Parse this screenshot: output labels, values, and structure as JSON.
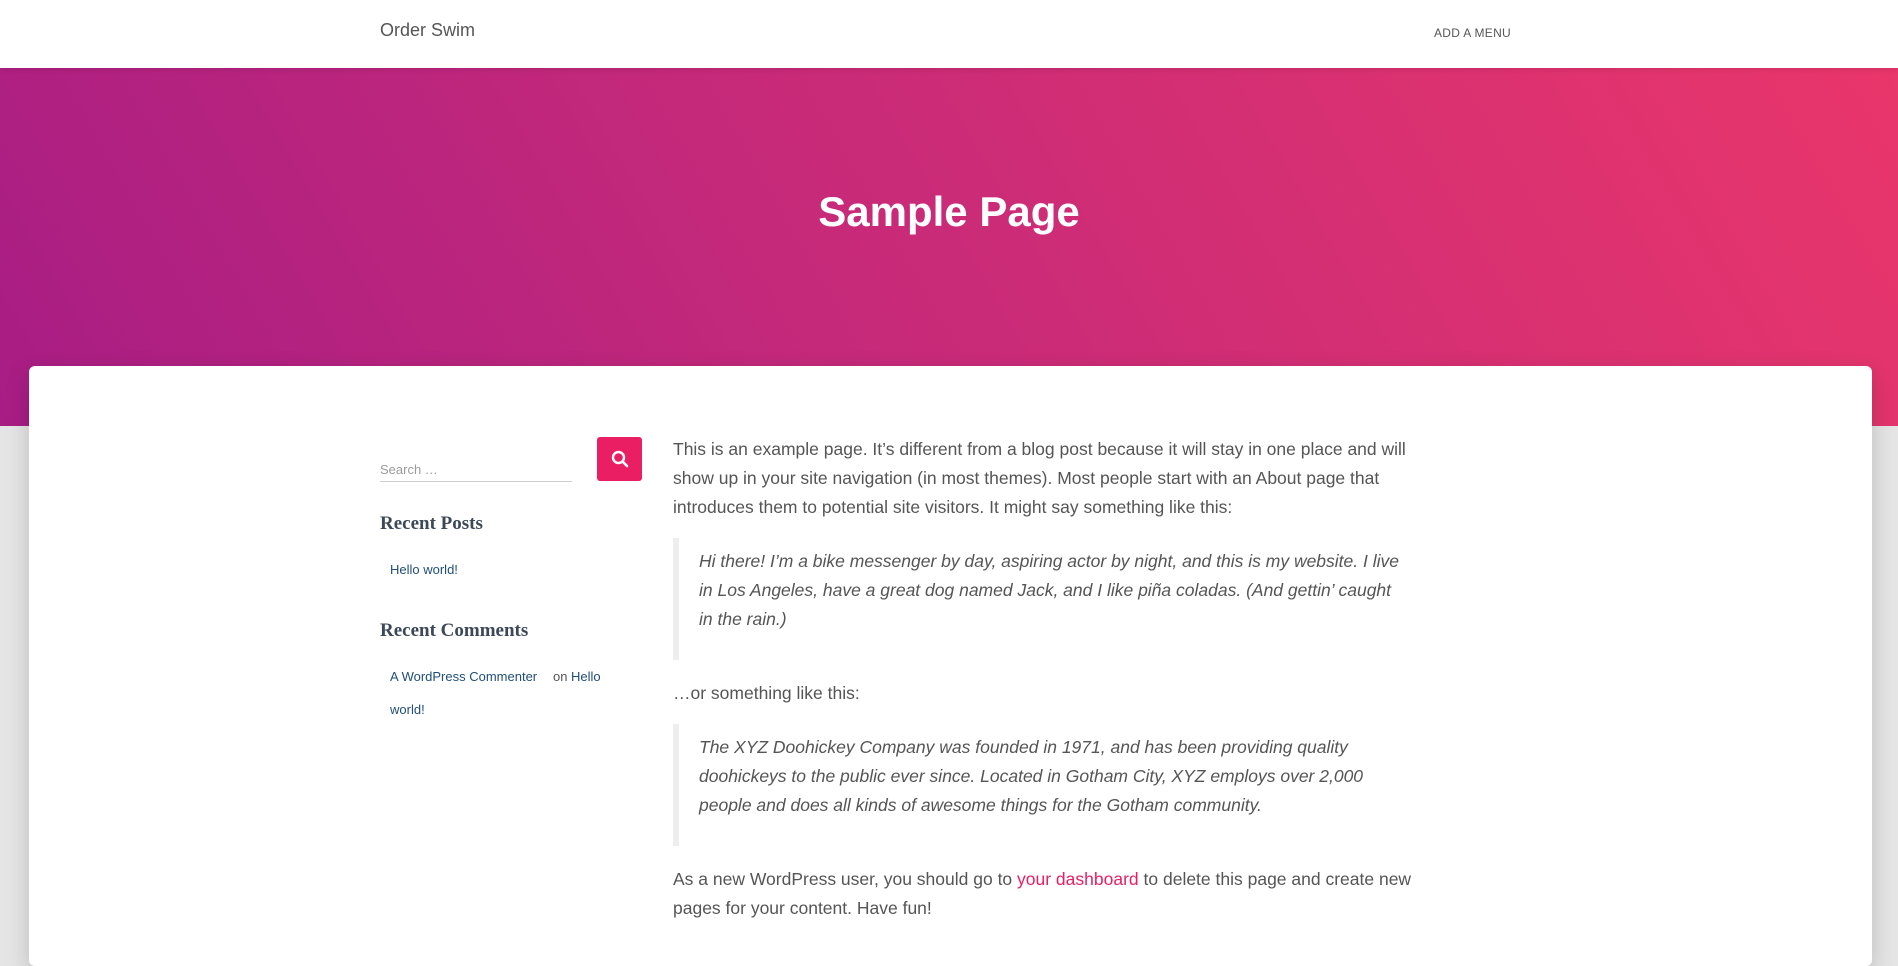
{
  "header": {
    "site_title": "Order Swim",
    "menu_label": "ADD A MENU"
  },
  "hero": {
    "title": "Sample Page"
  },
  "sidebar": {
    "search_placeholder": "Search …",
    "search_button_icon": "search-icon",
    "recent_posts_title": "Recent Posts",
    "recent_posts": [
      "Hello world!"
    ],
    "recent_comments_title": "Recent Comments",
    "comment_author": "A WordPress Commenter",
    "comment_on": "on",
    "comment_post_line1": "Hello",
    "comment_post_line2": "world!"
  },
  "content": {
    "para1_line1": "This is an example page. It’s different from a blog post because it will stay in one place and will",
    "para1_line2": "show up in your site navigation (in most themes). Most people start with an About page that",
    "para1_line3": "introduces them to potential site visitors. It might say something like this:",
    "quote1_line1": "Hi there! I’m a bike messenger by day, aspiring actor by night, and this is my website. I live",
    "quote1_line2": "in Los Angeles, have a great dog named Jack, and I like piña coladas. (And gettin’ caught",
    "quote1_line3": "in the rain.)",
    "para2": "…or something like this:",
    "quote2_line1": "The XYZ Doohickey Company was founded in 1971, and has been providing quality",
    "quote2_line2": "doohickeys to the public ever since. Located in Gotham City, XYZ employs over 2,000",
    "quote2_line3": "people and does all kinds of awesome things for the Gotham community.",
    "para3_before": "As a new WordPress user, you should go to ",
    "para3_link": "your dashboard",
    "para3_after": " to delete this page and create new",
    "para3_line2": "pages for your content. Have fun!"
  },
  "colors": {
    "accent": "#e91e63",
    "hero_gradient_start": "#a81d84",
    "hero_gradient_end": "#e9366b",
    "sidebar_link": "#1f4e7a"
  }
}
